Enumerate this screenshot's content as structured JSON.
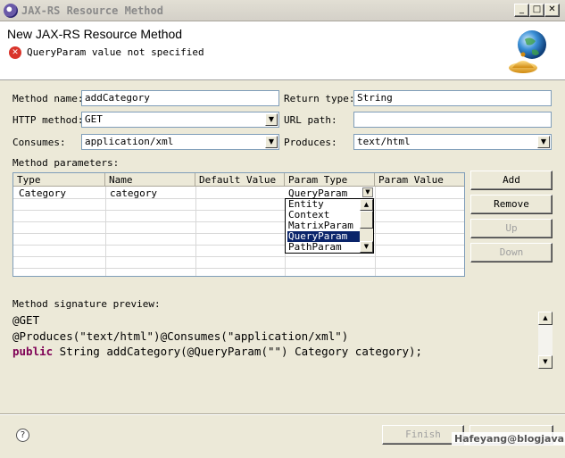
{
  "window": {
    "title": "JAX-RS Resource Method"
  },
  "header": {
    "title": "New JAX-RS Resource Method",
    "error_message": "QueryParam value not specified"
  },
  "form": {
    "method_name_label": "Method name:",
    "method_name_value": "addCategory",
    "return_type_label": "Return type:",
    "return_type_value": "String",
    "http_method_label": "HTTP method:",
    "http_method_value": "GET",
    "url_path_label": "URL path:",
    "url_path_value": "",
    "consumes_label": "Consumes:",
    "consumes_value": "application/xml",
    "produces_label": "Produces:",
    "produces_value": "text/html"
  },
  "params": {
    "label": "Method parameters:",
    "columns": [
      "Type",
      "Name",
      "Default Value",
      "Param Type",
      "Param Value"
    ],
    "rows": [
      {
        "type": "Category",
        "name": "category",
        "default": "",
        "param_type": "QueryParam",
        "param_value": ""
      }
    ],
    "dropdown_options": [
      "Entity",
      "Context",
      "MatrixParam",
      "QueryParam",
      "PathParam"
    ],
    "dropdown_selected": "QueryParam",
    "buttons": {
      "add": "Add",
      "remove": "Remove",
      "up": "Up",
      "down": "Down"
    }
  },
  "preview": {
    "label": "Method signature preview:",
    "line1": "@GET",
    "line2": "@Produces(\"text/html\")@Consumes(\"application/xml\")",
    "line3_kw": "public",
    "line3_rest": " String addCategory(@QueryParam(\"\") Category category);"
  },
  "footer": {
    "finish": "Finish",
    "watermark": "Hafeyang@blogjava"
  },
  "colors": {
    "error_red": "#d9342b",
    "keyword": "#7f0055",
    "selection": "#0a246a"
  }
}
